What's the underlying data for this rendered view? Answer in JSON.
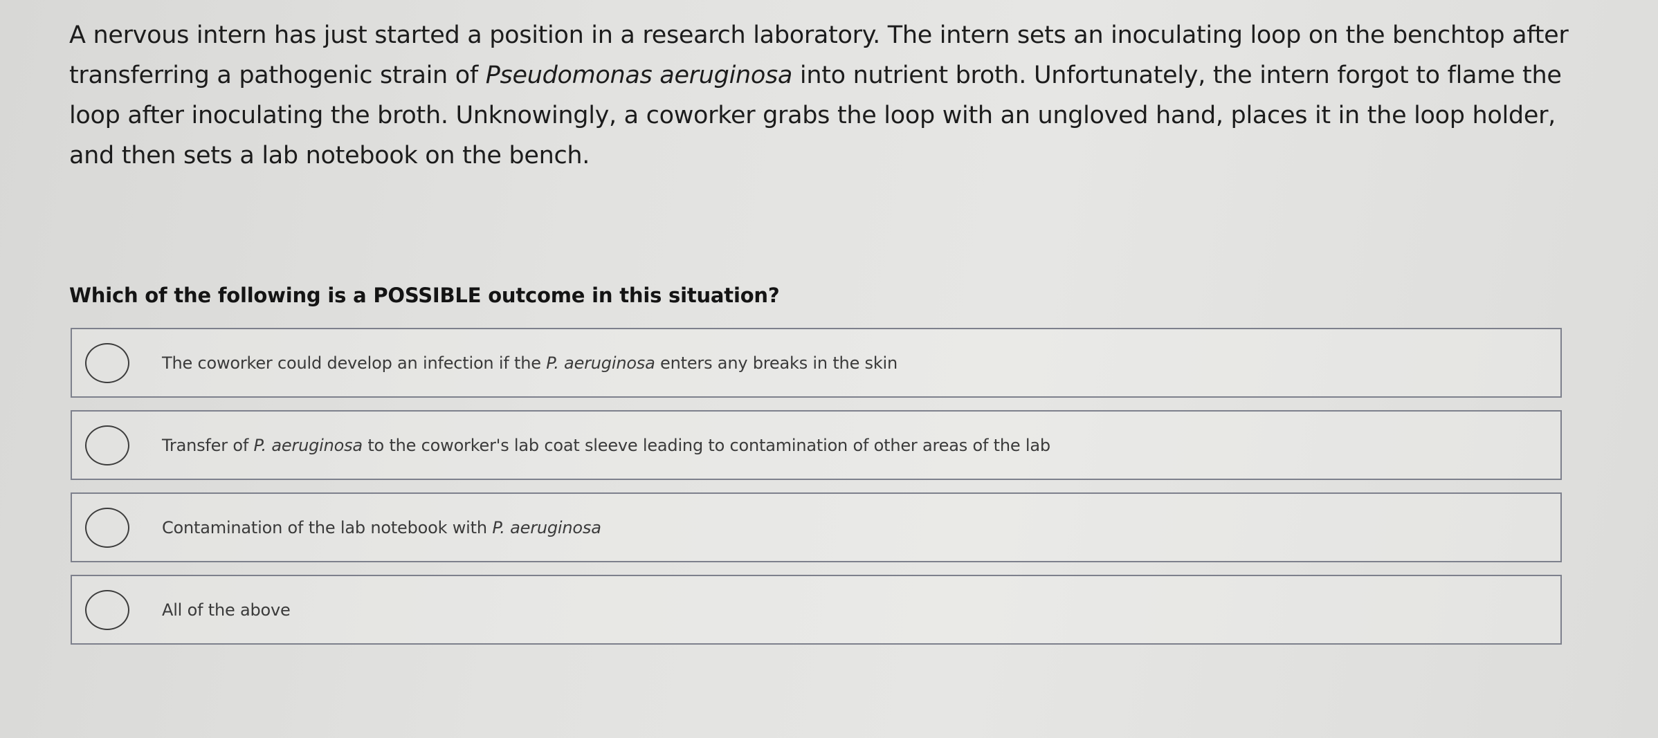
{
  "stem": {
    "part1": "A nervous intern has just started a position in a research laboratory. The intern sets an inoculating loop on the benchtop after transferring a pathogenic strain of ",
    "species": "Pseudomonas aeruginosa",
    "part2": " into nutrient broth. Unfortunately, the intern forgot to flame the loop after inoculating the broth. Unknowingly, a coworker grabs the loop with an ungloved hand, places it in the loop holder, and then sets a lab notebook on the bench."
  },
  "question": "Which of the following is a POSSIBLE outcome in this situation?",
  "options": [
    {
      "before": "The coworker could develop an infection if the ",
      "italic": "P. aeruginosa",
      "after": " enters any breaks in the skin"
    },
    {
      "before": "Transfer of ",
      "italic": "P. aeruginosa",
      "after": " to the coworker's lab coat sleeve leading to contamination of other areas of the lab"
    },
    {
      "before": "Contamination of the lab notebook with ",
      "italic": "P. aeruginosa",
      "after": ""
    },
    {
      "before": "All of the above",
      "italic": "",
      "after": ""
    }
  ]
}
